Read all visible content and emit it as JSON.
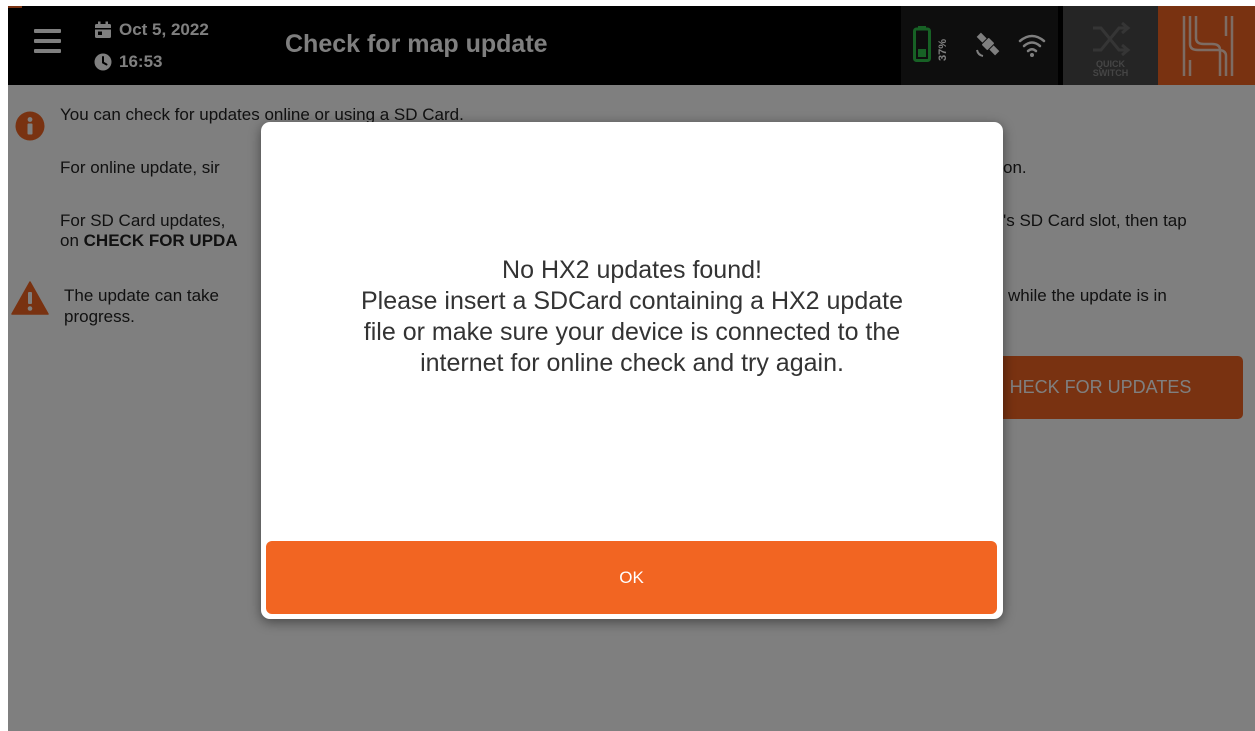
{
  "header": {
    "date": "Oct 5, 2022",
    "time": "16:53",
    "title": "Check for map update",
    "battery_percent": "37%",
    "quick_switch_label_line1": "QUICK",
    "quick_switch_label_line2": "SWITCH"
  },
  "content": {
    "info_line1": "You can check for updates online or using a SD Card.",
    "online_update_start": "For online update, sir",
    "online_update_end": "on.",
    "sdcard_update_start": "For SD Card updates,",
    "sdcard_update_end": "'s SD Card slot, then tap",
    "sdcard_update_line2_prefix": "on",
    "sdcard_update_line2_bold": "CHECK FOR UPDA",
    "warning_start": "The update can take",
    "warning_line2": "progress.",
    "warning_end": "while the update is in",
    "check_button_label": "HECK FOR UPDATES"
  },
  "dialog": {
    "message_lines": [
      "No HX2 updates found!",
      "Please insert a SDCard containing a HX2 update",
      "file or make sure your device is connected to the",
      "internet for online check and try again."
    ],
    "ok_label": "OK"
  },
  "colors": {
    "accent": "#f26522",
    "topbar": "#000000",
    "battery": "#2ec24a",
    "overlay": "rgba(0,0,0,0.5)"
  },
  "icons": {
    "menu": "hamburger-menu-icon",
    "date": "calendar-icon",
    "time": "clock-icon",
    "battery": "battery-icon",
    "satellite": "satellite-icon",
    "wifi": "wifi-icon",
    "quick_switch": "quick-switch-icon",
    "brand": "brand-logo",
    "info": "info-icon",
    "warning": "warning-icon"
  }
}
